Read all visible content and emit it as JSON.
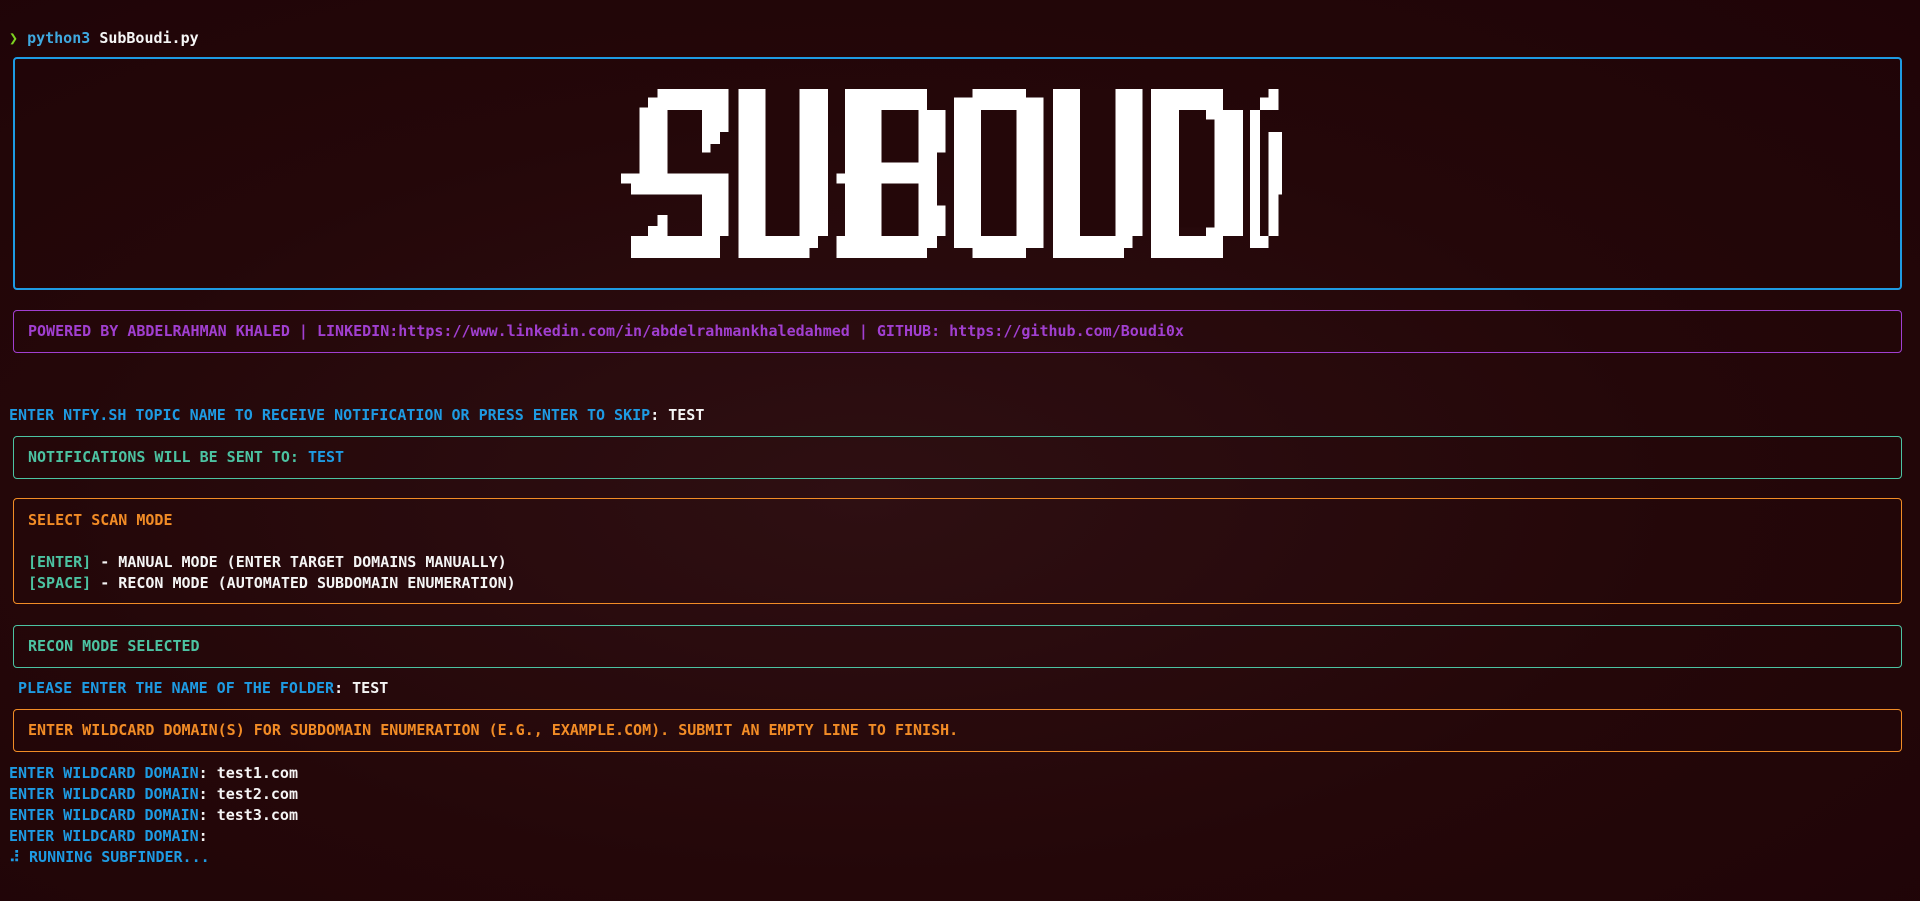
{
  "prompt": {
    "symbol": "❯",
    "command": "python3",
    "argument": "SubBoudi.py"
  },
  "logo": {
    "text": "SUBOUDI",
    "border_color": "#1e9be3"
  },
  "powered": {
    "text": "POWERED BY ABDELRAHMAN KHALED | LINKEDIN:https://www.linkedin.com/in/abdelrahmankhaledahmed | GITHUB: https://github.com/Boudi0x",
    "color": "#a13fd0"
  },
  "ntfy": {
    "prompt": "ENTER NTFY.SH TOPIC NAME TO RECEIVE NOTIFICATION OR PRESS ENTER TO SKIP",
    "value": "TEST"
  },
  "notifications": {
    "label": "NOTIFICATIONS WILL BE SENT TO:",
    "value": "TEST",
    "color": "#4cc3a2"
  },
  "scan_mode": {
    "title": "SELECT SCAN MODE",
    "options": [
      {
        "key": "[ENTER]",
        "desc": " - MANUAL MODE (ENTER TARGET DOMAINS MANUALLY)"
      },
      {
        "key": "[SPACE]",
        "desc": " - RECON MODE (AUTOMATED SUBDOMAIN ENUMERATION)"
      }
    ],
    "color": "#f28c26"
  },
  "recon_selected": {
    "text": "RECON MODE SELECTED"
  },
  "folder": {
    "prompt": "PLEASE ENTER THE NAME OF THE FOLDER",
    "value": "TEST"
  },
  "wildcard_info": {
    "text": "ENTER WILDCARD DOMAIN(S) FOR SUBDOMAIN ENUMERATION (E.G., EXAMPLE.COM). SUBMIT AN EMPTY LINE TO FINISH."
  },
  "wildcard_lines": [
    {
      "prompt": "ENTER WILDCARD DOMAIN",
      "value": "test1.com"
    },
    {
      "prompt": "ENTER WILDCARD DOMAIN",
      "value": "test2.com"
    },
    {
      "prompt": "ENTER WILDCARD DOMAIN",
      "value": "test3.com"
    },
    {
      "prompt": "ENTER WILDCARD DOMAIN",
      "value": ""
    }
  ],
  "status": {
    "spinner": "⠼",
    "text": "RUNNING SUBFINDER..."
  }
}
